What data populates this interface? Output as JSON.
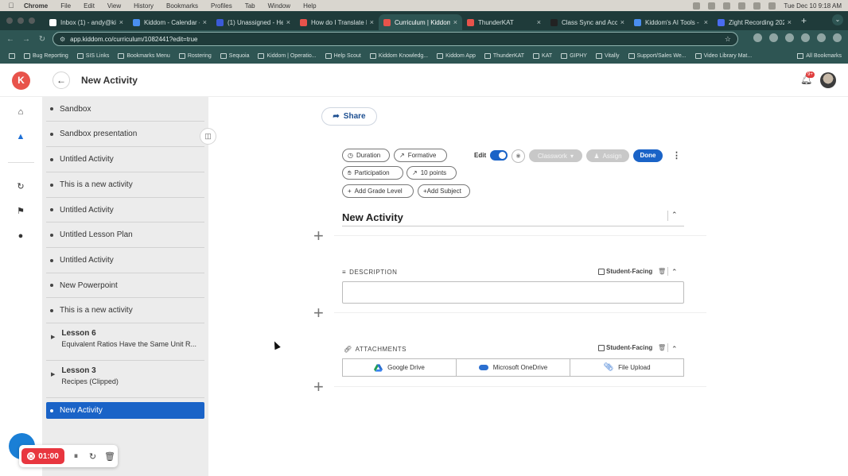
{
  "menubar": {
    "app": "Chrome",
    "items": [
      "File",
      "Edit",
      "View",
      "History",
      "Bookmarks",
      "Profiles",
      "Tab",
      "Window",
      "Help"
    ],
    "clock": "Tue Dec 10 9:18 AM"
  },
  "tabs": [
    {
      "title": "Inbox (1) - andy@kid",
      "color": "#ffffff",
      "active": false
    },
    {
      "title": "Kiddom - Calendar -",
      "color": "#4a8ef0",
      "active": false
    },
    {
      "title": "(1) Unassigned - Hel",
      "color": "#3b5ad8",
      "active": false
    },
    {
      "title": "How do I Translate K",
      "color": "#e8534b",
      "active": false
    },
    {
      "title": "Curriculum | Kiddom",
      "color": "#e8534b",
      "active": true
    },
    {
      "title": "ThunderKAT",
      "color": "#e8534b",
      "active": false
    },
    {
      "title": "Class Sync and Acco",
      "color": "#222222",
      "active": false
    },
    {
      "title": "Kiddom's AI Tools -",
      "color": "#4a8ef0",
      "active": false
    },
    {
      "title": "Zight Recording 202",
      "color": "#4a6cf0",
      "active": false
    }
  ],
  "address": {
    "url": "app.kiddom.co/curriculum/1082441?edit=true"
  },
  "bookmarks": [
    "Bug Reporting",
    "SIS Links",
    "Bookmarks Menu",
    "Rostering",
    "Sequoia",
    "Kiddom | Operatio...",
    "Help Scout",
    "Kiddom Knowledg...",
    "Kiddom App",
    "ThunderKAT",
    "KAT",
    "GIPHY",
    "Vitally",
    "Support/Sales We...",
    "Video Library Mat..."
  ],
  "bookmarks_all": "All Bookmarks",
  "header": {
    "logo": "K",
    "title": "New Activity",
    "notification_badge": "9+"
  },
  "sidebar": {
    "items": [
      {
        "label": "Sandbox"
      },
      {
        "label": "Sandbox presentation"
      },
      {
        "label": "Untitled Activity"
      },
      {
        "label": "This is a new activity"
      },
      {
        "label": "Untitled Activity"
      },
      {
        "label": "Untitled Lesson Plan"
      },
      {
        "label": "Untitled Activity"
      },
      {
        "label": "New Powerpoint"
      },
      {
        "label": "This is a new activity"
      }
    ],
    "lessons": [
      {
        "title": "Lesson 6",
        "subtitle": "Equivalent Ratios Have the Same Unit R..."
      },
      {
        "title": "Lesson 3",
        "subtitle": "Recipes (Clipped)"
      }
    ],
    "active_item": "New Activity"
  },
  "main": {
    "share_label": "Share",
    "chips": {
      "duration": "Duration",
      "formative": "Formative",
      "participation": "Participation",
      "points": "10 points",
      "add_grade": "Add Grade Level",
      "add_subject": "+Add Subject"
    },
    "edit_label": "Edit",
    "classwork_label": "Classwork",
    "assign_label": "Assign",
    "done_label": "Done",
    "activity_title": "New Activity",
    "description": {
      "label": "DESCRIPTION",
      "student_facing": "Student-Facing",
      "value": ""
    },
    "attachments": {
      "label": "ATTACHMENTS",
      "student_facing": "Student-Facing",
      "options": [
        "Google Drive",
        "Microsoft OneDrive",
        "File Upload"
      ]
    }
  },
  "recorder": {
    "time": "01:00"
  },
  "colors": {
    "accent": "#1a63c7",
    "brand": "#e8534b",
    "record": "#e8363f"
  }
}
